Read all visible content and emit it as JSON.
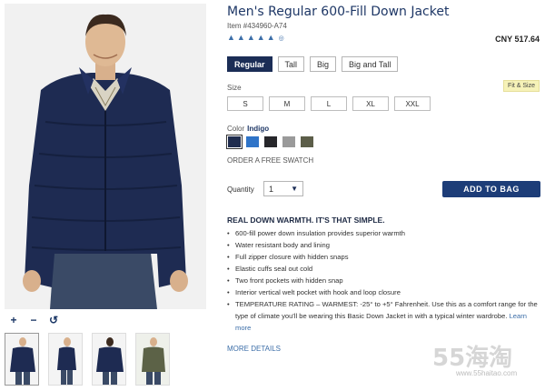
{
  "product": {
    "title": "Men's Regular 600-Fill Down Jacket",
    "item_number": "Item #434960-A74",
    "rating_icons": [
      "star-icon",
      "star-icon",
      "star-icon",
      "star-icon",
      "star-icon"
    ],
    "reviews_icon": "review-icon",
    "price": "CNY 517.64"
  },
  "fit": {
    "options": [
      "Regular",
      "Tall",
      "Big",
      "Big and Tall"
    ],
    "selected": "Regular"
  },
  "size": {
    "label": "Size",
    "fit_size_link": "Fit & Size",
    "options": [
      "S",
      "M",
      "L",
      "XL",
      "XXL"
    ]
  },
  "color": {
    "label": "Color",
    "selected_name": "Indigo",
    "swatches": [
      "#1f2c4e",
      "#2f74c8",
      "#27272b",
      "#9a9a9a",
      "#5c5e49"
    ],
    "swatch_link": "ORDER A FREE SWATCH"
  },
  "quantity": {
    "label": "Quantity",
    "value": "1"
  },
  "cart": {
    "button_label": "ADD TO BAG"
  },
  "description": {
    "heading": "REAL DOWN WARMTH. IT'S THAT SIMPLE.",
    "bullets": [
      "600-fill power down insulation provides superior warmth",
      "Water resistant body and lining",
      "Full zipper closure with hidden snaps",
      "Elastic cuffs seal out cold",
      "Two front pockets with hidden snap",
      "Interior vertical welt pocket with hook and loop closure",
      "TEMPERATURE RATING – WARMEST: -25° to +5° Fahrenheit. Use this as a comfort range for the type of climate you'll be wearing this Basic Down Jacket in with a typical winter wardrobe."
    ],
    "learn_more": "Learn more",
    "more_details": "MORE DETAILS"
  },
  "gallery": {
    "zoom_in": "+",
    "zoom_out": "−",
    "reset": "↺",
    "thumbnails": [
      "front-view",
      "side-view",
      "back-view",
      "alternate-color-view"
    ]
  },
  "watermark": {
    "logo": "55海淘",
    "url": "www.55haitao.com"
  }
}
